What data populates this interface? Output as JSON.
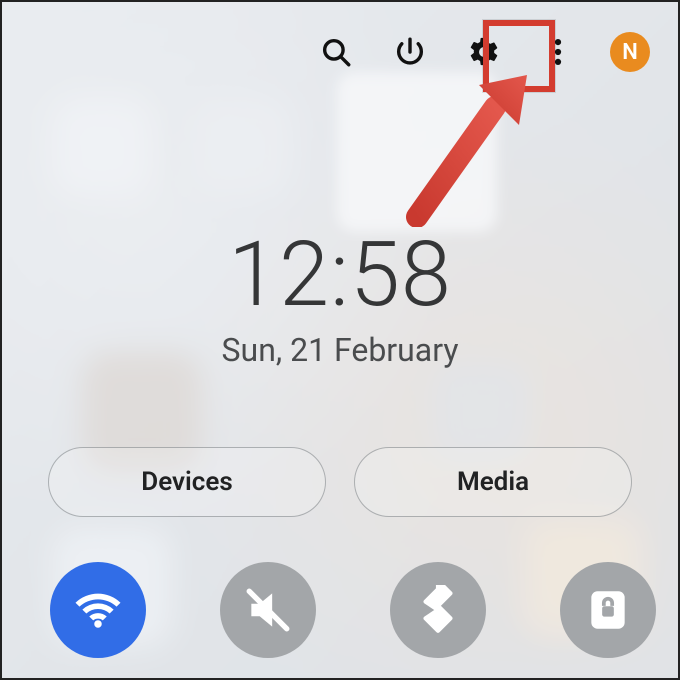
{
  "time": "12:58",
  "date": "Sun, 21 February",
  "avatar_letter": "N",
  "colors": {
    "highlight": "#e0392a",
    "avatar_bg": "#f28a12",
    "quick_toggle_active": "#2b6df5",
    "quick_toggle_inactive": "#a3a6a9"
  },
  "pills": {
    "devices": "Devices",
    "media": "Media"
  },
  "toolbar_icons": [
    "search-icon",
    "power-icon",
    "gear-icon",
    "more-icon"
  ],
  "annotation": {
    "arrow_points_to": "gear-icon"
  },
  "quick_toggles": [
    {
      "name": "wifi",
      "active": true
    },
    {
      "name": "mute",
      "active": false
    },
    {
      "name": "bluetooth",
      "active": false
    },
    {
      "name": "lock",
      "active": false
    }
  ]
}
